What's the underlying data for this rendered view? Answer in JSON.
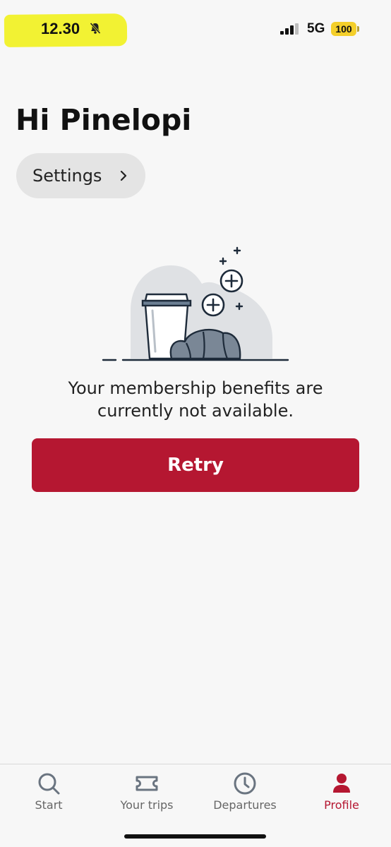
{
  "status_bar": {
    "time": "12.30",
    "network": "5G",
    "battery": "100",
    "icons": [
      "bell-slash-icon",
      "signal-icon"
    ]
  },
  "greeting": "Hi Pinelopi",
  "settings": {
    "label": "Settings",
    "icon": "chevron-right-icon"
  },
  "illustration": {
    "icon": "coffee-croissant-illustration"
  },
  "message": {
    "line1": "Your membership benefits are",
    "line2": "currently not available."
  },
  "retry_label": "Retry",
  "tabs": [
    {
      "label": "Start",
      "icon": "search-icon"
    },
    {
      "label": "Your trips",
      "icon": "ticket-icon"
    },
    {
      "label": "Departures",
      "icon": "clock-icon"
    },
    {
      "label": "Profile",
      "icon": "person-icon",
      "active": true
    }
  ],
  "colors": {
    "accent": "#b51731",
    "highlight": "#f2f233",
    "battery": "#f4cf2a"
  }
}
